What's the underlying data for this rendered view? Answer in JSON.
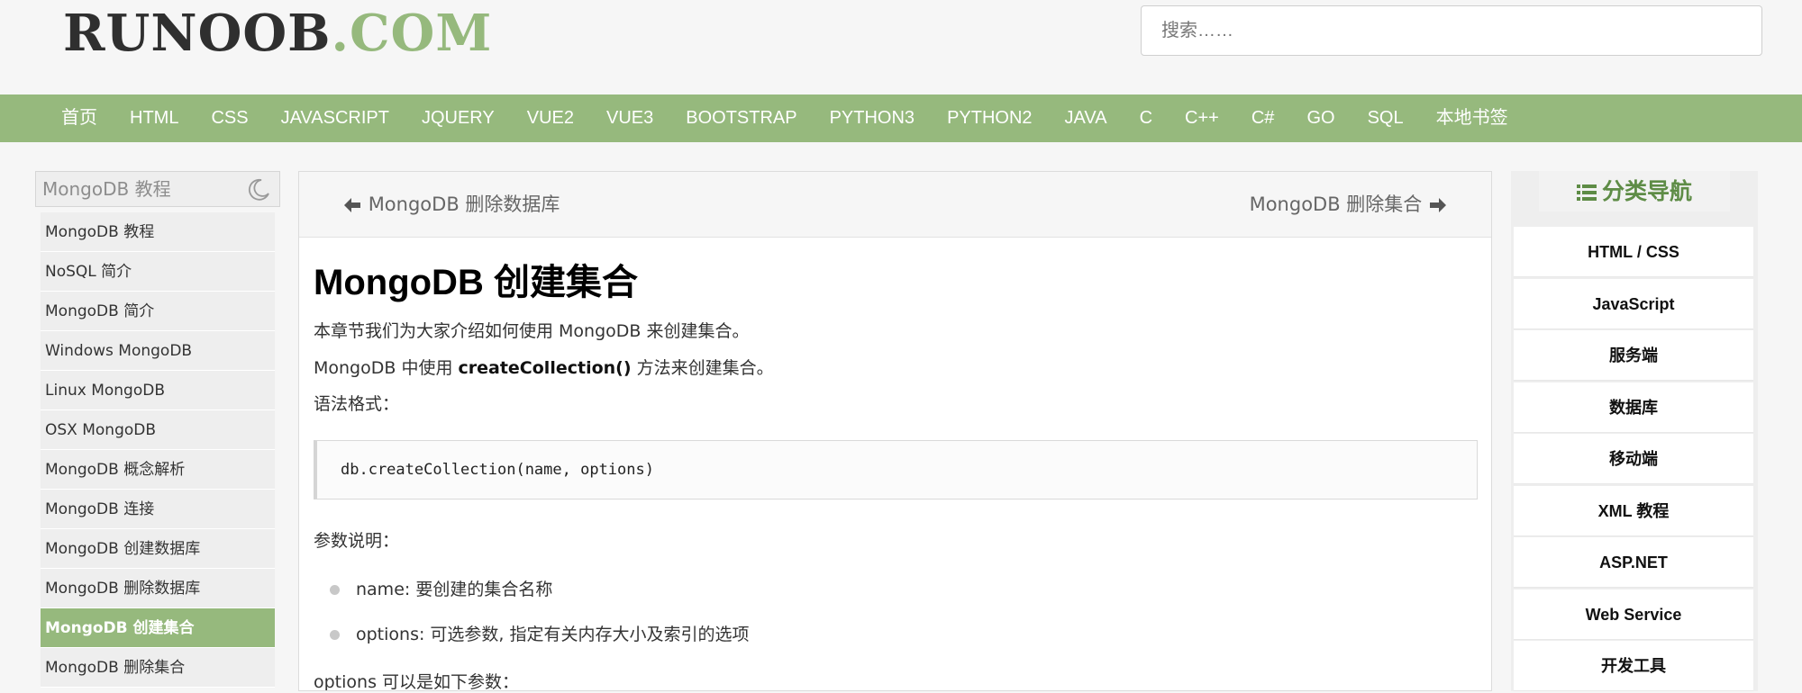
{
  "header": {
    "logo_main": "RUNOOB",
    "logo_suffix": ".COM",
    "search_placeholder": "搜索……"
  },
  "nav": {
    "items": [
      "首页",
      "HTML",
      "CSS",
      "JAVASCRIPT",
      "JQUERY",
      "VUE2",
      "VUE3",
      "BOOTSTRAP",
      "PYTHON3",
      "PYTHON2",
      "JAVA",
      "C",
      "C++",
      "C#",
      "GO",
      "SQL",
      "本地书签"
    ]
  },
  "left_sidebar": {
    "title": "MongoDB 教程",
    "theme_toggle_icon": "moon-icon",
    "active_index": 10,
    "items": [
      "MongoDB 教程",
      "NoSQL 简介",
      "MongoDB 简介",
      "Windows MongoDB",
      "Linux MongoDB",
      "OSX MongoDB",
      "MongoDB 概念解析",
      "MongoDB 连接",
      "MongoDB 创建数据库",
      "MongoDB 删除数据库",
      "MongoDB 创建集合",
      "MongoDB 删除集合"
    ]
  },
  "main": {
    "prev_link": "MongoDB 删除数据库",
    "next_link": "MongoDB 删除集合",
    "title": "MongoDB 创建集合",
    "intro": "本章节我们为大家介绍如何使用 MongoDB 来创建集合。",
    "usage_prefix": "MongoDB 中使用 ",
    "usage_method": "createCollection()",
    "usage_suffix": " 方法来创建集合。",
    "syntax_label": "语法格式：",
    "code": "db.createCollection(name, options)",
    "params_label": "参数说明：",
    "params": [
      "name: 要创建的集合名称",
      "options: 可选参数, 指定有关内存大小及索引的选项"
    ],
    "options_line": "options 可以是如下参数："
  },
  "right_sidebar": {
    "title": "分类导航",
    "icon": "list-icon",
    "items": [
      "HTML / CSS",
      "JavaScript",
      "服务端",
      "数据库",
      "移动端",
      "XML 教程",
      "ASP.NET",
      "Web Service",
      "开发工具"
    ]
  },
  "colors": {
    "brand_green": "#96b97d",
    "header_bg": "#f6f6f6",
    "nav_title_green": "#5e8c46"
  }
}
